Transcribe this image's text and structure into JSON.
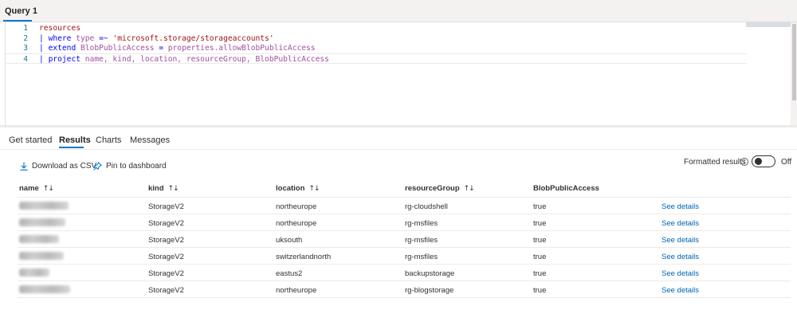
{
  "query_tab": {
    "label": "Query 1"
  },
  "editor": {
    "lines": [
      {
        "num": "1",
        "segments": [
          {
            "t": "resources",
            "c": "kw"
          }
        ]
      },
      {
        "num": "2",
        "segments": [
          {
            "t": "| ",
            "c": "pipe"
          },
          {
            "t": "where",
            "c": "op"
          },
          {
            "t": " type ",
            "c": "ident"
          },
          {
            "t": "=~",
            "c": "op"
          },
          {
            "t": " 'microsoft.storage/storageaccounts'",
            "c": "str"
          }
        ]
      },
      {
        "num": "3",
        "segments": [
          {
            "t": "| ",
            "c": "pipe"
          },
          {
            "t": "extend",
            "c": "op"
          },
          {
            "t": " BlobPublicAccess ",
            "c": "ident"
          },
          {
            "t": "=",
            "c": "op"
          },
          {
            "t": " properties.allowBlobPublicAccess",
            "c": "ident"
          }
        ]
      },
      {
        "num": "4",
        "segments": [
          {
            "t": "| ",
            "c": "pipe"
          },
          {
            "t": "project",
            "c": "op"
          },
          {
            "t": " name, kind, location, resourceGroup, BlobPublicAccess",
            "c": "ident"
          }
        ]
      }
    ]
  },
  "tabs": [
    {
      "label": "Get started",
      "active": false
    },
    {
      "label": "Results",
      "active": true
    },
    {
      "label": "Charts",
      "active": false
    },
    {
      "label": "Messages",
      "active": false
    }
  ],
  "toolbar": {
    "download_label": "Download as CSV",
    "pin_label": "Pin to dashboard",
    "formatted_label": "Formatted results",
    "toggle_state_label": "Off",
    "accent": "#0078d4"
  },
  "table": {
    "columns": [
      "name",
      "kind",
      "location",
      "resourceGroup",
      "BlobPublicAccess"
    ],
    "rows": [
      {
        "kind": "StorageV2",
        "location": "northeurope",
        "resourceGroup": "rg-cloudshell",
        "BlobPublicAccess": "true",
        "details": "See details"
      },
      {
        "kind": "StorageV2",
        "location": "northeurope",
        "resourceGroup": "rg-msfiles",
        "BlobPublicAccess": "true",
        "details": "See details"
      },
      {
        "kind": "StorageV2",
        "location": "uksouth",
        "resourceGroup": "rg-msfiles",
        "BlobPublicAccess": "true",
        "details": "See details"
      },
      {
        "kind": "StorageV2",
        "location": "switzerlandnorth",
        "resourceGroup": "rg-msfiles",
        "BlobPublicAccess": "true",
        "details": "See details"
      },
      {
        "kind": "StorageV2",
        "location": "eastus2",
        "resourceGroup": "backupstorage",
        "BlobPublicAccess": "true",
        "details": "See details"
      },
      {
        "kind": "StorageV2",
        "location": "northeurope",
        "resourceGroup": "rg-blogstorage",
        "BlobPublicAccess": "true",
        "details": "See details"
      }
    ]
  }
}
